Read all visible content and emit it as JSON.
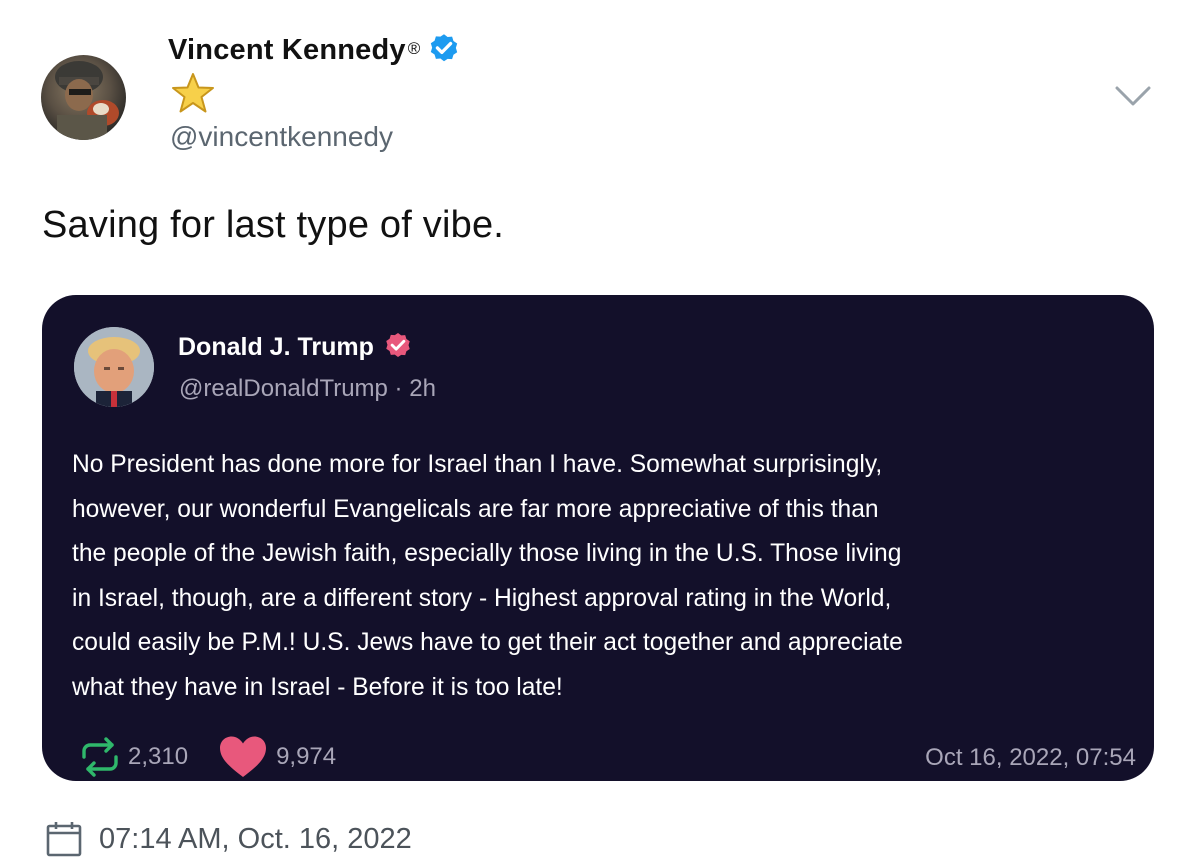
{
  "tweet": {
    "author": {
      "name": "Vincent Kennedy",
      "name_suffix": "®",
      "emoji": "⭐",
      "handle": "@vincentkennedy",
      "verified_color": "#1d9bf0"
    },
    "text": "Saving for last type of vibe.",
    "timestamp": "07:14 AM, Oct. 16, 2022",
    "menu_icon": "chevron-down-icon"
  },
  "quoted_post": {
    "author": {
      "name": "Donald J. Trump",
      "handle": "@realDonaldTrump",
      "separator": " · ",
      "age": "2h",
      "verified_color": "#e8587c"
    },
    "body": "No President has done more for Israel than I have. Somewhat surprisingly,\nhowever, our wonderful Evangelicals are far more appreciative of this than\nthe people of the Jewish faith, especially those living in the U.S. Those living\nin Israel, though, are a different story - Highest approval rating in the World,\ncould easily be P.M.! U.S. Jews have to get their act together and appreciate\nwhat they have in Israel - Before it is too late!",
    "stats": {
      "retweets": "2,310",
      "likes": "9,974"
    },
    "date": "Oct 16, 2022, 07:54",
    "colors": {
      "background": "#13102a",
      "retweet": "#2fb86b",
      "like": "#e8587c"
    }
  }
}
